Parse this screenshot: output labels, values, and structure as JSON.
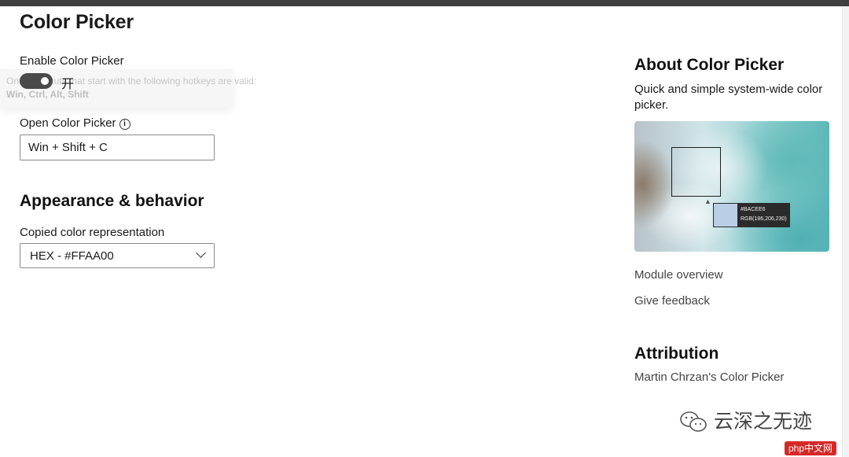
{
  "page_title": "Color Picker",
  "enable": {
    "label": "Enable Color Picker",
    "state_text": "开"
  },
  "ghost_tooltip": {
    "line1": "Only shortcuts that start with the following hotkeys are valid:",
    "line2": "Win, Ctrl, Alt, Shift"
  },
  "open_picker": {
    "label": "Open Color Picker",
    "info_icon": "info-icon",
    "value": "Win + Shift + C"
  },
  "appearance": {
    "title": "Appearance & behavior",
    "copied_label": "Copied color representation",
    "copied_value": "HEX - #FFAA00",
    "chevron_icon": "chevron-down-icon"
  },
  "about": {
    "title": "About Color Picker",
    "description": "Quick and simple system-wide color picker.",
    "hero": {
      "hex": "#BACEE6",
      "rgb": "RGB(186,206,230)",
      "swatch_color": "#BACEE6"
    },
    "links": [
      "Module overview",
      "Give feedback"
    ]
  },
  "attribution": {
    "title": "Attribution",
    "text": "Martin Chrzan's Color Picker"
  },
  "watermark": {
    "text": "云深之无迹",
    "badge": "php中文网"
  },
  "colors": {
    "toggle_on": "#4A4A4A",
    "border": "#8A8A8A",
    "link": "#444444"
  }
}
